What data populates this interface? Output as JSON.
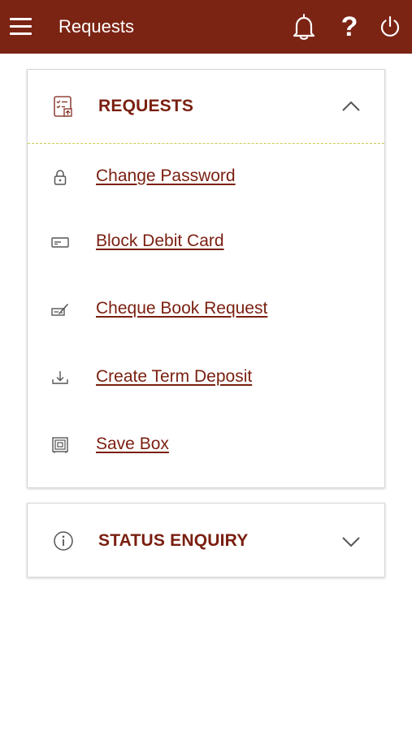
{
  "header": {
    "title": "Requests",
    "help_label": "?",
    "menu_icon": "hamburger-menu-icon",
    "bell_icon": "bell-icon",
    "power_icon": "power-icon"
  },
  "requests_panel": {
    "title": "REQUESTS",
    "expanded": true,
    "items": [
      {
        "label": "Change Password",
        "icon": "lock-icon"
      },
      {
        "label": "Block Debit Card",
        "icon": "card-icon"
      },
      {
        "label": "Cheque Book Request",
        "icon": "cheque-icon"
      },
      {
        "label": "Create Term Deposit",
        "icon": "download-icon"
      },
      {
        "label": "Save Box",
        "icon": "safe-box-icon"
      }
    ]
  },
  "status_panel": {
    "title": "STATUS ENQUIRY",
    "expanded": false
  },
  "colors": {
    "appbar": "#7b2414",
    "text_accent": "#7a1f10",
    "divider": "#c7cc4a"
  }
}
